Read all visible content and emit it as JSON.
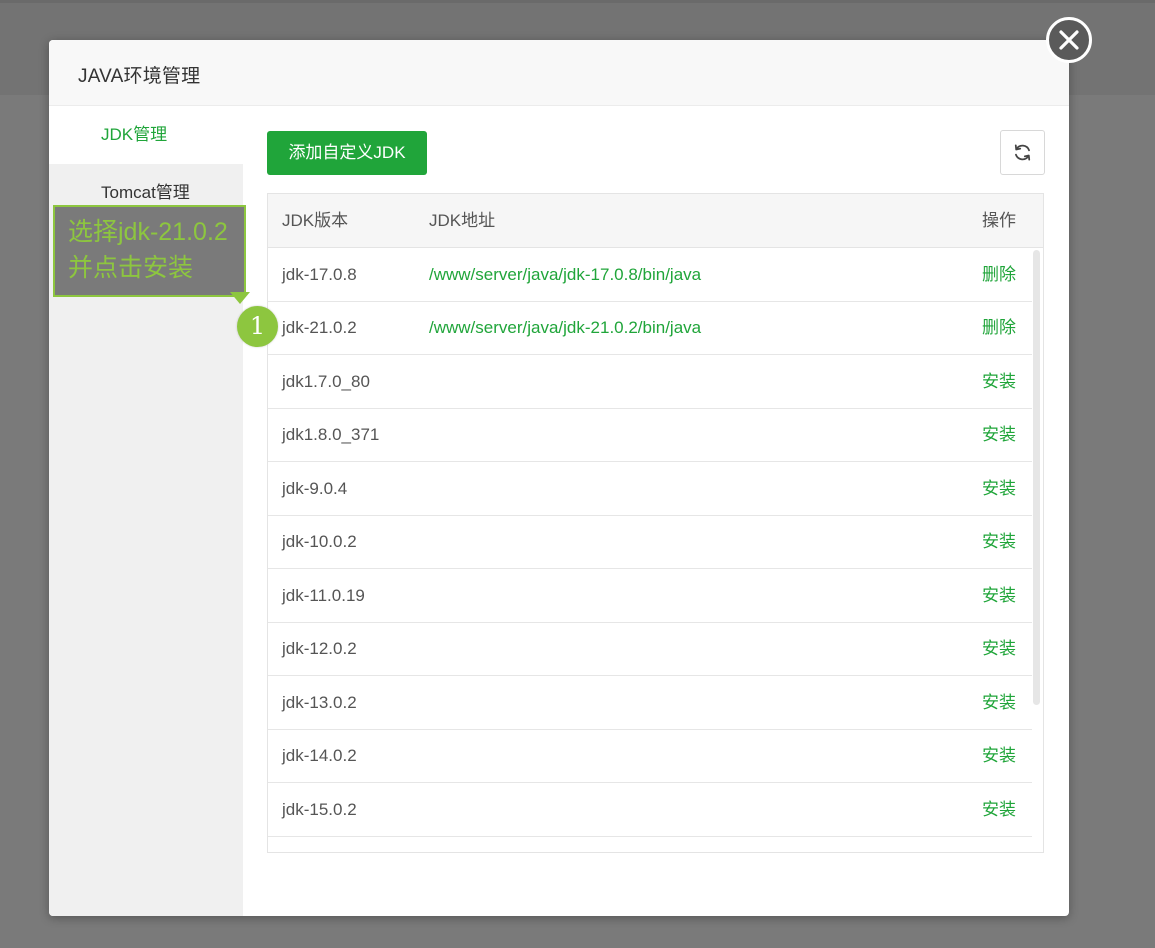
{
  "dialog": {
    "title": "JAVA环境管理"
  },
  "sidebar": {
    "items": [
      {
        "label": "JDK管理"
      },
      {
        "label": "Tomcat管理"
      }
    ]
  },
  "toolbar": {
    "add_label": "添加自定义JDK",
    "refresh_icon": "refresh-icon"
  },
  "table": {
    "headers": {
      "version": "JDK版本",
      "path": "JDK地址",
      "op": "操作"
    },
    "rows": [
      {
        "version": "jdk-17.0.8",
        "path": "/www/server/java/jdk-17.0.8/bin/java",
        "op": "删除"
      },
      {
        "version": "jdk-21.0.2",
        "path": "/www/server/java/jdk-21.0.2/bin/java",
        "op": "删除"
      },
      {
        "version": "jdk1.7.0_80",
        "path": "",
        "op": "安装"
      },
      {
        "version": "jdk1.8.0_371",
        "path": "",
        "op": "安装"
      },
      {
        "version": "jdk-9.0.4",
        "path": "",
        "op": "安装"
      },
      {
        "version": "jdk-10.0.2",
        "path": "",
        "op": "安装"
      },
      {
        "version": "jdk-11.0.19",
        "path": "",
        "op": "安装"
      },
      {
        "version": "jdk-12.0.2",
        "path": "",
        "op": "安装"
      },
      {
        "version": "jdk-13.0.2",
        "path": "",
        "op": "安装"
      },
      {
        "version": "jdk-14.0.2",
        "path": "",
        "op": "安装"
      },
      {
        "version": "jdk-15.0.2",
        "path": "",
        "op": "安装"
      }
    ]
  },
  "annotation": {
    "line1": "选择jdk-21.0.2",
    "line2": "并点击安装",
    "step": "1"
  },
  "colors": {
    "accent": "#20a53a",
    "annotation": "#8dc63f",
    "overlay": "#7a7a7a"
  }
}
